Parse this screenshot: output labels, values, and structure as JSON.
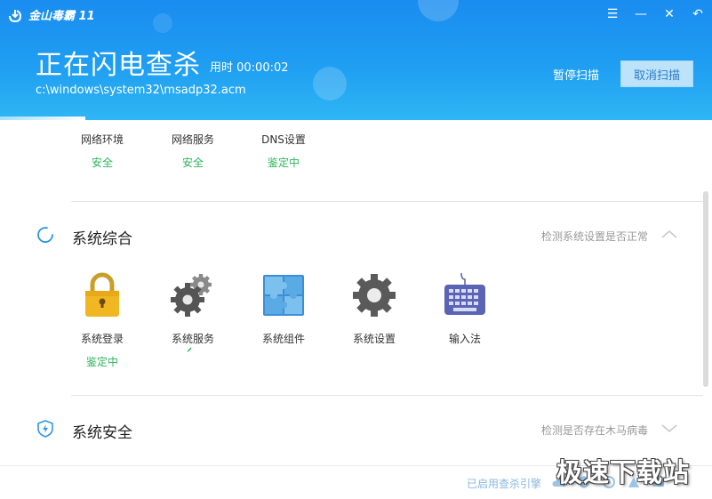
{
  "app": {
    "title": "金山毒霸 11"
  },
  "window_controls": {
    "menu": "☰",
    "minimize": "—",
    "close": "✕",
    "back": "↶"
  },
  "scan": {
    "title": "正在闪电查杀",
    "time_label": "用时 00:00:02",
    "current_path": "c:\\windows\\system32\\msadp32.acm",
    "pause_label": "暂停扫描",
    "cancel_label": "取消扫描",
    "progress_percent": 12
  },
  "network": {
    "items": [
      {
        "label": "网络环境",
        "status": "安全"
      },
      {
        "label": "网络服务",
        "status": "安全"
      },
      {
        "label": "DNS设置",
        "status": "鉴定中"
      }
    ]
  },
  "sections": [
    {
      "title": "系统综合",
      "desc": "检测系统设置是否正常",
      "expanded": true,
      "icon": "loading-circle-icon"
    },
    {
      "title": "系统安全",
      "desc": "检测是否存在木马病毒",
      "expanded": false,
      "icon": "shield-lightning-icon"
    }
  ],
  "system_items": [
    {
      "label": "系统登录",
      "status": "鉴定中",
      "icon": "padlock-icon"
    },
    {
      "label": "系统服务",
      "status": "",
      "icon": "gears-icon"
    },
    {
      "label": "系统组件",
      "status": "",
      "icon": "puzzle-icon"
    },
    {
      "label": "系统设置",
      "status": "",
      "icon": "gear-icon"
    },
    {
      "label": "输入法",
      "status": "",
      "icon": "keyboard-icon"
    }
  ],
  "footer": {
    "engine_text": "已启用查杀引擎"
  },
  "watermark": "极速下载站",
  "colors": {
    "header_blue": "#1f9ef2",
    "status_green": "#2fb45b",
    "cancel_bg": "#bde3fb"
  }
}
